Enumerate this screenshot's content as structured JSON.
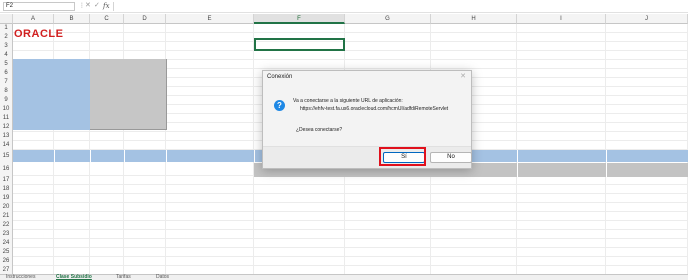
{
  "formula_bar": {
    "name_box": "F2",
    "more_icon": "⋮",
    "cancel_icon": "✕",
    "enter_icon": "✓",
    "fx_label": "fx",
    "content": ""
  },
  "columns": [
    "A",
    "B",
    "C",
    "D",
    "E",
    "F",
    "G",
    "H",
    "I",
    "J"
  ],
  "selected_column": "F",
  "rows": [
    "1",
    "2",
    "3",
    "4",
    "5",
    "6",
    "7",
    "8",
    "9",
    "10",
    "11",
    "12",
    "13",
    "14",
    "15",
    "16",
    "17",
    "18",
    "19",
    "20",
    "21",
    "22",
    "23",
    "24",
    "25",
    "26",
    "27"
  ],
  "logo_text": "ORACLE",
  "colors": {
    "selection_green": "#217346",
    "header_blue": "#a4c2e3",
    "gray_fill": "#c6c6c6",
    "oracle_red": "#d11f1f",
    "highlight_red": "#e0101c",
    "info_blue": "#1e88e5"
  },
  "sheet_tabs": [
    {
      "label": "Instrucciones",
      "active": false
    },
    {
      "label": "Clase Subsidio",
      "active": true
    },
    {
      "label": "Tarifas",
      "active": false
    },
    {
      "label": "Datos",
      "active": false
    }
  ],
  "dialog": {
    "title": "Conexión",
    "close_icon": "✕",
    "info_icon": "?",
    "message": "Va a conectarse a la siguiente URL de aplicación:",
    "url": "https://ehfv-test.fa.us6.oraclecloud.com/hcmUI/adfdiRemoteServlet",
    "question": "¿Desea conectarse?",
    "yes_label": "Sí",
    "no_label": "No"
  }
}
